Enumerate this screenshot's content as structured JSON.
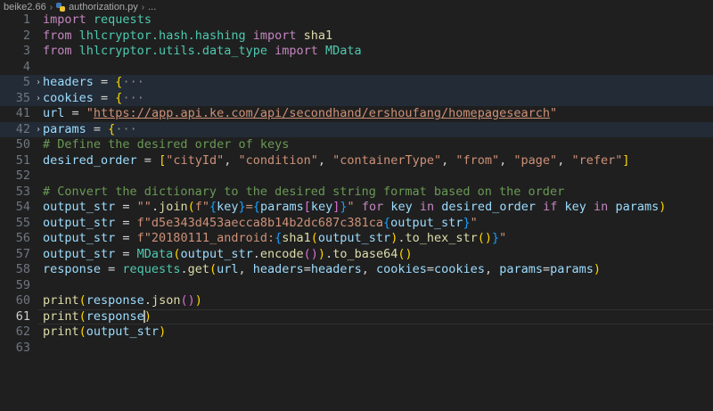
{
  "breadcrumb": {
    "folder": "beike2.66",
    "file": "authorization.py",
    "more": "..."
  },
  "editor": {
    "active_line": 61,
    "lines": [
      {
        "no": "1",
        "tokens": [
          [
            "kw",
            "import"
          ],
          [
            "op",
            " "
          ],
          [
            "mod",
            "requests"
          ]
        ]
      },
      {
        "no": "2",
        "tokens": [
          [
            "kw",
            "from"
          ],
          [
            "op",
            " "
          ],
          [
            "mod",
            "lhlcryptor.hash.hashing"
          ],
          [
            "op",
            " "
          ],
          [
            "kw",
            "import"
          ],
          [
            "op",
            " "
          ],
          [
            "fn",
            "sha1"
          ]
        ]
      },
      {
        "no": "3",
        "tokens": [
          [
            "kw",
            "from"
          ],
          [
            "op",
            " "
          ],
          [
            "mod",
            "lhlcryptor.utils.data_type"
          ],
          [
            "op",
            " "
          ],
          [
            "kw",
            "import"
          ],
          [
            "op",
            " "
          ],
          [
            "cls",
            "MData"
          ]
        ]
      },
      {
        "no": "4",
        "tokens": []
      },
      {
        "no": "5",
        "fold": true,
        "highlight": true,
        "tokens": [
          [
            "var",
            "headers"
          ],
          [
            "op",
            " = "
          ],
          [
            "p1",
            "{"
          ],
          [
            "fold",
            "···"
          ]
        ]
      },
      {
        "no": "35",
        "fold": true,
        "highlight": true,
        "tokens": [
          [
            "var",
            "cookies"
          ],
          [
            "op",
            " = "
          ],
          [
            "p1",
            "{"
          ],
          [
            "fold",
            "···"
          ]
        ]
      },
      {
        "no": "41",
        "tokens": [
          [
            "var",
            "url"
          ],
          [
            "op",
            " = "
          ],
          [
            "str",
            "\""
          ],
          [
            "url",
            "https://app.api.ke.com/api/secondhand/ershoufang/homepagesearch"
          ],
          [
            "str",
            "\""
          ]
        ]
      },
      {
        "no": "42",
        "fold": true,
        "highlight": true,
        "tokens": [
          [
            "var",
            "params"
          ],
          [
            "op",
            " = "
          ],
          [
            "p1",
            "{"
          ],
          [
            "fold",
            "···"
          ]
        ]
      },
      {
        "no": "50",
        "tokens": [
          [
            "cm",
            "# Define the desired order of keys"
          ]
        ]
      },
      {
        "no": "51",
        "tokens": [
          [
            "var",
            "desired_order"
          ],
          [
            "op",
            " = "
          ],
          [
            "p1",
            "["
          ],
          [
            "str",
            "\"cityId\""
          ],
          [
            "op",
            ", "
          ],
          [
            "str",
            "\"condition\""
          ],
          [
            "op",
            ", "
          ],
          [
            "str",
            "\"containerType\""
          ],
          [
            "op",
            ", "
          ],
          [
            "str",
            "\"from\""
          ],
          [
            "op",
            ", "
          ],
          [
            "str",
            "\"page\""
          ],
          [
            "op",
            ", "
          ],
          [
            "str",
            "\"refer\""
          ],
          [
            "p1",
            "]"
          ]
        ]
      },
      {
        "no": "52",
        "tokens": []
      },
      {
        "no": "53",
        "tokens": [
          [
            "cm",
            "# Convert the dictionary to the desired string format based on the order"
          ]
        ]
      },
      {
        "no": "54",
        "tokens": [
          [
            "var",
            "output_str"
          ],
          [
            "op",
            " = "
          ],
          [
            "str",
            "\"\""
          ],
          [
            "op",
            "."
          ],
          [
            "fn",
            "join"
          ],
          [
            "p1",
            "("
          ],
          [
            "str",
            "f\""
          ],
          [
            "p3",
            "{"
          ],
          [
            "var",
            "key"
          ],
          [
            "p3",
            "}"
          ],
          [
            "str",
            "="
          ],
          [
            "p3",
            "{"
          ],
          [
            "var",
            "params"
          ],
          [
            "p2",
            "["
          ],
          [
            "var",
            "key"
          ],
          [
            "p2",
            "]"
          ],
          [
            "p3",
            "}"
          ],
          [
            "str",
            "\""
          ],
          [
            "op",
            " "
          ],
          [
            "kw",
            "for"
          ],
          [
            "op",
            " "
          ],
          [
            "var",
            "key"
          ],
          [
            "op",
            " "
          ],
          [
            "kw",
            "in"
          ],
          [
            "op",
            " "
          ],
          [
            "var",
            "desired_order"
          ],
          [
            "op",
            " "
          ],
          [
            "kw",
            "if"
          ],
          [
            "op",
            " "
          ],
          [
            "var",
            "key"
          ],
          [
            "op",
            " "
          ],
          [
            "kw",
            "in"
          ],
          [
            "op",
            " "
          ],
          [
            "var",
            "params"
          ],
          [
            "p1",
            ")"
          ]
        ]
      },
      {
        "no": "55",
        "tokens": [
          [
            "var",
            "output_str"
          ],
          [
            "op",
            " = "
          ],
          [
            "str",
            "f\"d5e343d453aecca8b14b2dc687c381ca"
          ],
          [
            "p3",
            "{"
          ],
          [
            "var",
            "output_str"
          ],
          [
            "p3",
            "}"
          ],
          [
            "str",
            "\""
          ]
        ]
      },
      {
        "no": "56",
        "tokens": [
          [
            "var",
            "output_str"
          ],
          [
            "op",
            " = "
          ],
          [
            "str",
            "f\"20180111_android:"
          ],
          [
            "p3",
            "{"
          ],
          [
            "fn",
            "sha1"
          ],
          [
            "p1",
            "("
          ],
          [
            "var",
            "output_str"
          ],
          [
            "p1",
            ")"
          ],
          [
            "op",
            "."
          ],
          [
            "fn",
            "to_hex_str"
          ],
          [
            "p1",
            "()"
          ],
          [
            "p3",
            "}"
          ],
          [
            "str",
            "\""
          ]
        ]
      },
      {
        "no": "57",
        "tokens": [
          [
            "var",
            "output_str"
          ],
          [
            "op",
            " = "
          ],
          [
            "cls",
            "MData"
          ],
          [
            "p1",
            "("
          ],
          [
            "var",
            "output_str"
          ],
          [
            "op",
            "."
          ],
          [
            "fn",
            "encode"
          ],
          [
            "p2",
            "()"
          ],
          [
            "p1",
            ")"
          ],
          [
            "op",
            "."
          ],
          [
            "fn",
            "to_base64"
          ],
          [
            "p1",
            "()"
          ]
        ]
      },
      {
        "no": "58",
        "tokens": [
          [
            "var",
            "response"
          ],
          [
            "op",
            " = "
          ],
          [
            "mod",
            "requests"
          ],
          [
            "op",
            "."
          ],
          [
            "fn",
            "get"
          ],
          [
            "p1",
            "("
          ],
          [
            "var",
            "url"
          ],
          [
            "op",
            ", "
          ],
          [
            "var",
            "headers"
          ],
          [
            "op",
            "="
          ],
          [
            "var",
            "headers"
          ],
          [
            "op",
            ", "
          ],
          [
            "var",
            "cookies"
          ],
          [
            "op",
            "="
          ],
          [
            "var",
            "cookies"
          ],
          [
            "op",
            ", "
          ],
          [
            "var",
            "params"
          ],
          [
            "op",
            "="
          ],
          [
            "var",
            "params"
          ],
          [
            "p1",
            ")"
          ]
        ]
      },
      {
        "no": "59",
        "tokens": []
      },
      {
        "no": "60",
        "tokens": [
          [
            "fn",
            "print"
          ],
          [
            "p1",
            "("
          ],
          [
            "var",
            "response"
          ],
          [
            "op",
            "."
          ],
          [
            "fn",
            "json"
          ],
          [
            "p2",
            "()"
          ],
          [
            "p1",
            ")"
          ]
        ]
      },
      {
        "no": "61",
        "cursor_line": true,
        "tokens": [
          [
            "fn",
            "print"
          ],
          [
            "p1",
            "("
          ],
          [
            "var",
            "response"
          ],
          [
            "p1",
            ")"
          ]
        ]
      },
      {
        "no": "62",
        "tokens": [
          [
            "fn",
            "print"
          ],
          [
            "p1",
            "("
          ],
          [
            "var",
            "output_str"
          ],
          [
            "p1",
            ")"
          ]
        ]
      },
      {
        "no": "63",
        "tokens": []
      }
    ]
  },
  "colors": {
    "background": "#1f1f1f",
    "folded_highlight": "#222b36",
    "keyword": "#c586c0",
    "variable": "#9cdcfe",
    "string": "#ce9178",
    "function": "#dcdcaa",
    "comment": "#6a9955",
    "class": "#4ec9b0"
  }
}
